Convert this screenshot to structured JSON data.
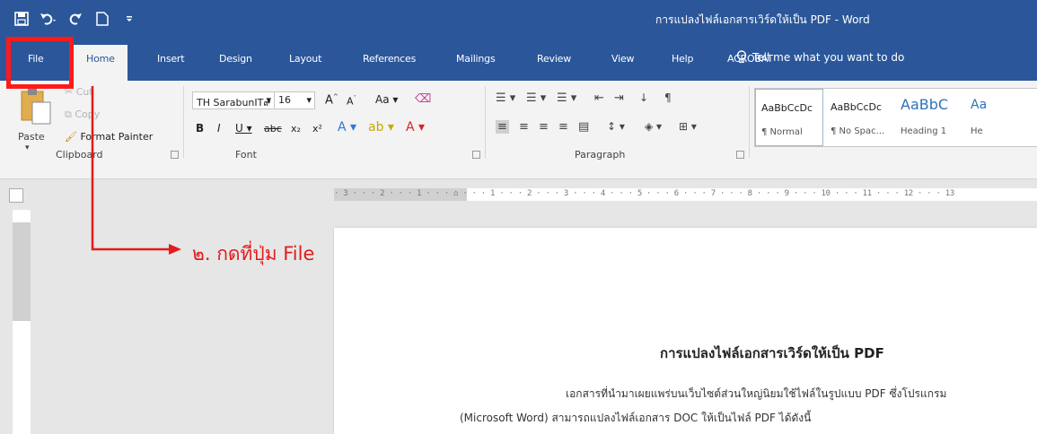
{
  "window": {
    "title": "การแปลงไฟล์เอกสารเวิร์ดให้เป็น PDF - Word"
  },
  "quick_access": [
    {
      "icon": "save-icon"
    },
    {
      "icon": "undo-icon"
    },
    {
      "icon": "redo-icon"
    },
    {
      "icon": "new-document-icon"
    },
    {
      "icon": "customize-toolbar-icon"
    }
  ],
  "tabs": [
    "File",
    "Home",
    "Insert",
    "Design",
    "Layout",
    "References",
    "Mailings",
    "Review",
    "View",
    "Help",
    "ACROBAT"
  ],
  "active_tab": "Home",
  "tell_me": "Tell me what you want to do",
  "clipboard": {
    "paste": "Paste",
    "cut": "Cut",
    "copy": "Copy",
    "format_painter": "Format Painter",
    "label": "Clipboard"
  },
  "font": {
    "family": "TH SarabunIT๙",
    "size": "16",
    "change_case": "Aa",
    "label": "Font"
  },
  "paragraph": {
    "label": "Paragraph"
  },
  "styles": [
    {
      "preview": "AaBbCcDc",
      "name": "¶ Normal"
    },
    {
      "preview": "AaBbCcDc",
      "name": "¶ No Spac..."
    },
    {
      "preview": "AaBbC",
      "name": "Heading 1"
    },
    {
      "preview": "Aa",
      "name": "He"
    }
  ],
  "ruler": {
    "scale": "· 3 · · · 2 · · · 1 · · · ⌂ · · · 1 · · · 2 · · · 3 · · · 4 · · · 5 · · · 6 · · · 7 · · · 8 · · · 9 · · · 10 · · · 11 · · · 12 · · · 13"
  },
  "document": {
    "heading": "การแปลงไฟล์เอกสารเวิร์ดให้เป็น PDF",
    "line1": "เอกสารที่นำมาเผยแพร่บนเว็บไซต์ส่วนใหญ่นิยมใช้ไฟล์ในรูปแบบ PDF ซึ่งโปรแกรม",
    "line2": "(Microsoft Word) สามารถแปลงไฟล์เอกสาร DOC ให้เป็นไฟล์ PDF ได้ดังนี้"
  },
  "annotation": {
    "step_text": "๒. กดที่ปุ่ม File",
    "color": "#e31b1b"
  },
  "colors": {
    "ribbon_blue": "#2b579a",
    "ribbon_body": "#f3f3f3"
  }
}
